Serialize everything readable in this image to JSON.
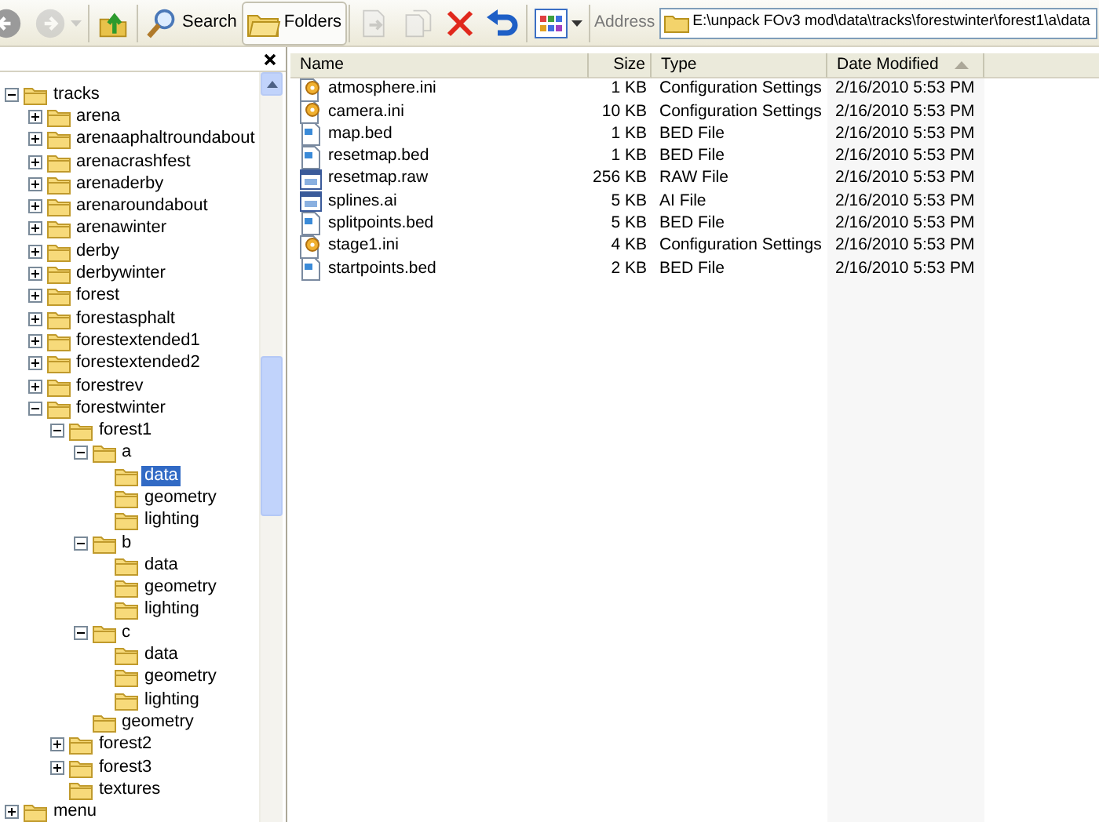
{
  "toolbar": {
    "buttons": [
      {
        "kind": "back",
        "disabled": false,
        "pressed": false
      },
      {
        "kind": "forward",
        "disabled": true,
        "pressed": false
      },
      {
        "kind": "up",
        "disabled": false,
        "pressed": false
      },
      {
        "kind": "search",
        "label": "Search",
        "disabled": false,
        "pressed": false
      },
      {
        "kind": "folders",
        "label": "Folders",
        "disabled": false,
        "pressed": true
      },
      {
        "kind": "move",
        "disabled": true,
        "pressed": false
      },
      {
        "kind": "copy",
        "disabled": true,
        "pressed": false
      },
      {
        "kind": "delete",
        "disabled": false,
        "pressed": false
      },
      {
        "kind": "undo",
        "disabled": false,
        "pressed": false
      },
      {
        "kind": "views",
        "disabled": false,
        "pressed": false
      }
    ],
    "address": {
      "label": "Address",
      "value": "E:\\unpack FOv3 mod\\data\\tracks\\forestwinter\\forest1\\a\\data"
    }
  },
  "tree": [
    {
      "label": "tracks",
      "expanded": true,
      "selected": false,
      "children": [
        {
          "label": "arena",
          "expanded": false,
          "selected": false
        },
        {
          "label": "arenaaphaltroundabout",
          "expanded": false,
          "selected": false
        },
        {
          "label": "arenacrashfest",
          "expanded": false,
          "selected": false
        },
        {
          "label": "arenaderby",
          "expanded": false,
          "selected": false
        },
        {
          "label": "arenaroundabout",
          "expanded": false,
          "selected": false
        },
        {
          "label": "arenawinter",
          "expanded": false,
          "selected": false
        },
        {
          "label": "derby",
          "expanded": false,
          "selected": false
        },
        {
          "label": "derbywinter",
          "expanded": false,
          "selected": false
        },
        {
          "label": "forest",
          "expanded": false,
          "selected": false
        },
        {
          "label": "forestasphalt",
          "expanded": false,
          "selected": false
        },
        {
          "label": "forestextended1",
          "expanded": false,
          "selected": false
        },
        {
          "label": "forestextended2",
          "expanded": false,
          "selected": false
        },
        {
          "label": "forestrev",
          "expanded": false,
          "selected": false
        },
        {
          "label": "forestwinter",
          "expanded": true,
          "selected": false,
          "children": [
            {
              "label": "forest1",
              "expanded": true,
              "selected": false,
              "children": [
                {
                  "label": "a",
                  "expanded": true,
                  "selected": false,
                  "children": [
                    {
                      "label": "data",
                      "selected": true
                    },
                    {
                      "label": "geometry",
                      "selected": false
                    },
                    {
                      "label": "lighting",
                      "selected": false
                    }
                  ]
                },
                {
                  "label": "b",
                  "expanded": true,
                  "selected": false,
                  "children": [
                    {
                      "label": "data",
                      "selected": false
                    },
                    {
                      "label": "geometry",
                      "selected": false
                    },
                    {
                      "label": "lighting",
                      "selected": false
                    }
                  ]
                },
                {
                  "label": "c",
                  "expanded": true,
                  "selected": false,
                  "children": [
                    {
                      "label": "data",
                      "selected": false
                    },
                    {
                      "label": "geometry",
                      "selected": false
                    },
                    {
                      "label": "lighting",
                      "selected": false
                    }
                  ]
                },
                {
                  "label": "geometry",
                  "selected": false
                }
              ]
            },
            {
              "label": "forest2",
              "expanded": false,
              "selected": false
            },
            {
              "label": "forest3",
              "expanded": false,
              "selected": false
            },
            {
              "label": "textures",
              "selected": false
            }
          ]
        }
      ]
    },
    {
      "label": "menu",
      "expanded": false,
      "selected": false
    }
  ],
  "columns": [
    {
      "label": "Name",
      "sorted": false
    },
    {
      "label": "Size",
      "sorted": false
    },
    {
      "label": "Type",
      "sorted": false
    },
    {
      "label": "Date Modified",
      "sorted": true
    }
  ],
  "files": [
    {
      "kind": "settings",
      "name": "atmosphere.ini",
      "size": "1 KB",
      "type": "Configuration Settings",
      "modified": "2/16/2010 5:53 PM"
    },
    {
      "kind": "settings",
      "name": "camera.ini",
      "size": "10 KB",
      "type": "Configuration Settings",
      "modified": "2/16/2010 5:53 PM"
    },
    {
      "kind": "document",
      "name": "map.bed",
      "size": "1 KB",
      "type": "BED File",
      "modified": "2/16/2010 5:53 PM"
    },
    {
      "kind": "document",
      "name": "resetmap.bed",
      "size": "1 KB",
      "type": "BED File",
      "modified": "2/16/2010 5:53 PM"
    },
    {
      "kind": "app",
      "name": "resetmap.raw",
      "size": "256 KB",
      "type": "RAW File",
      "modified": "2/16/2010 5:53 PM"
    },
    {
      "kind": "app",
      "name": "splines.ai",
      "size": "5 KB",
      "type": "AI File",
      "modified": "2/16/2010 5:53 PM"
    },
    {
      "kind": "document",
      "name": "splitpoints.bed",
      "size": "5 KB",
      "type": "BED File",
      "modified": "2/16/2010 5:53 PM"
    },
    {
      "kind": "settings",
      "name": "stage1.ini",
      "size": "4 KB",
      "type": "Configuration Settings",
      "modified": "2/16/2010 5:53 PM"
    },
    {
      "kind": "document",
      "name": "startpoints.bed",
      "size": "2 KB",
      "type": "BED File",
      "modified": "2/16/2010 5:53 PM"
    }
  ]
}
